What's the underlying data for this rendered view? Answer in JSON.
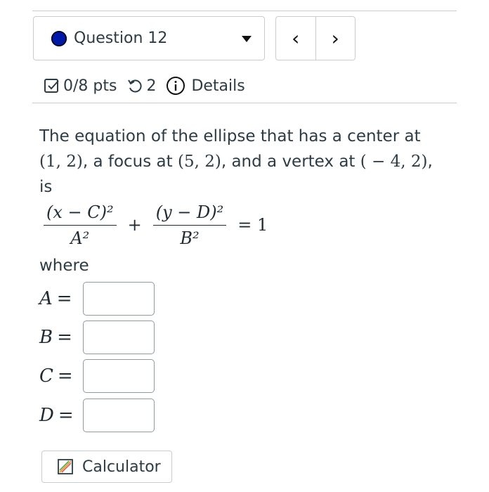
{
  "question": {
    "label": "Question 12",
    "prev_symbol": "‹",
    "next_symbol": "›"
  },
  "meta": {
    "points": "0/8 pts",
    "attempts": "2",
    "details": "Details"
  },
  "prompt": {
    "text_1": "The equation of the ellipse that has a center at",
    "center": "(1, 2)",
    "text_2": ", a focus at ",
    "focus": "(5, 2)",
    "text_3": ", and a vertex at ",
    "vertex": "( − 4, 2)",
    "text_4": ",",
    "text_5": "is"
  },
  "equation": {
    "num1": "(x − C)²",
    "den1": "A²",
    "plus": "+",
    "num2": "(y − D)²",
    "den2": "B²",
    "equals_one": "= 1"
  },
  "where": "where",
  "answers": [
    {
      "var": "A",
      "eq": "=",
      "value": ""
    },
    {
      "var": "B",
      "eq": "=",
      "value": ""
    },
    {
      "var": "C",
      "eq": "=",
      "value": ""
    },
    {
      "var": "D",
      "eq": "=",
      "value": ""
    }
  ],
  "calculator": {
    "label": "Calculator"
  },
  "colors": {
    "status_dot": "#0018a8",
    "border": "#c7cdd1",
    "text": "#2d3b45"
  }
}
